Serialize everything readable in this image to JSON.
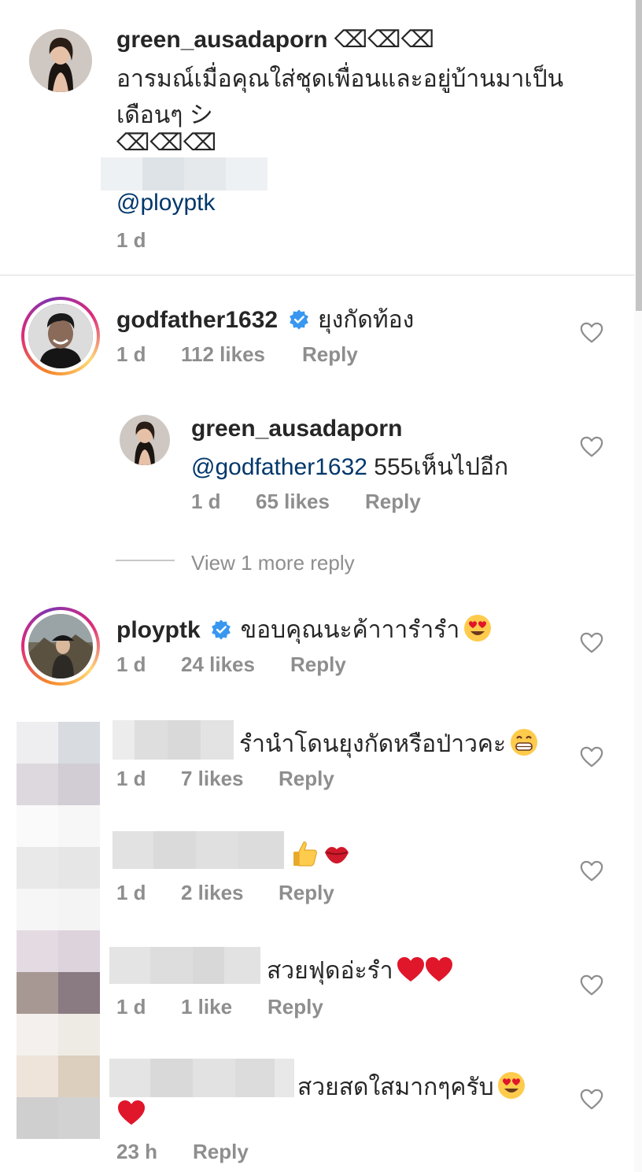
{
  "caption": {
    "username": "green_ausadaporn",
    "username_suffix": " ⌫⌫⌫",
    "line1": "อารมณ์เมื่อคุณใส่ชุดเพื่อนและอยู่บ้านมาเป็น",
    "line2": "เดือนๆ シ",
    "line3": "⌫⌫⌫",
    "mention": "@ployptk",
    "time": "1 d"
  },
  "comments": [
    {
      "username": "godfather1632",
      "verified": true,
      "text": "ยุงกัดท้อง",
      "time": "1 d",
      "likes": "112 likes",
      "reply": "Reply"
    },
    {
      "username": "green_ausadaporn",
      "mention": "@godfather1632",
      "text": " 555เห็นไปอีก",
      "time": "1 d",
      "likes": "65 likes",
      "reply": "Reply"
    },
    {
      "username": "ployptk",
      "verified": true,
      "text": "ขอบคุณนะค้าาารำรำ",
      "time": "1 d",
      "likes": "24 likes",
      "reply": "Reply"
    },
    {
      "text": "รำนำโดนยุงกัดหรือป่าวคะ",
      "time": "1 d",
      "likes": "7 likes",
      "reply": "Reply"
    },
    {
      "text": "",
      "time": "1 d",
      "likes": "2 likes",
      "reply": "Reply"
    },
    {
      "text": "สวยฟุดอ่ะรำ",
      "time": "1 d",
      "likes": "1 like",
      "reply": "Reply"
    },
    {
      "text": "สวยสดใสมากๆครับ",
      "time": "23 h",
      "reply": "Reply"
    }
  ],
  "view_more": "View 1 more reply",
  "colors": {
    "text": "#262626",
    "meta": "#8e8e8e",
    "mention": "#00376b",
    "verified": "#3897f0",
    "heart_emoji": "#e0162b"
  }
}
